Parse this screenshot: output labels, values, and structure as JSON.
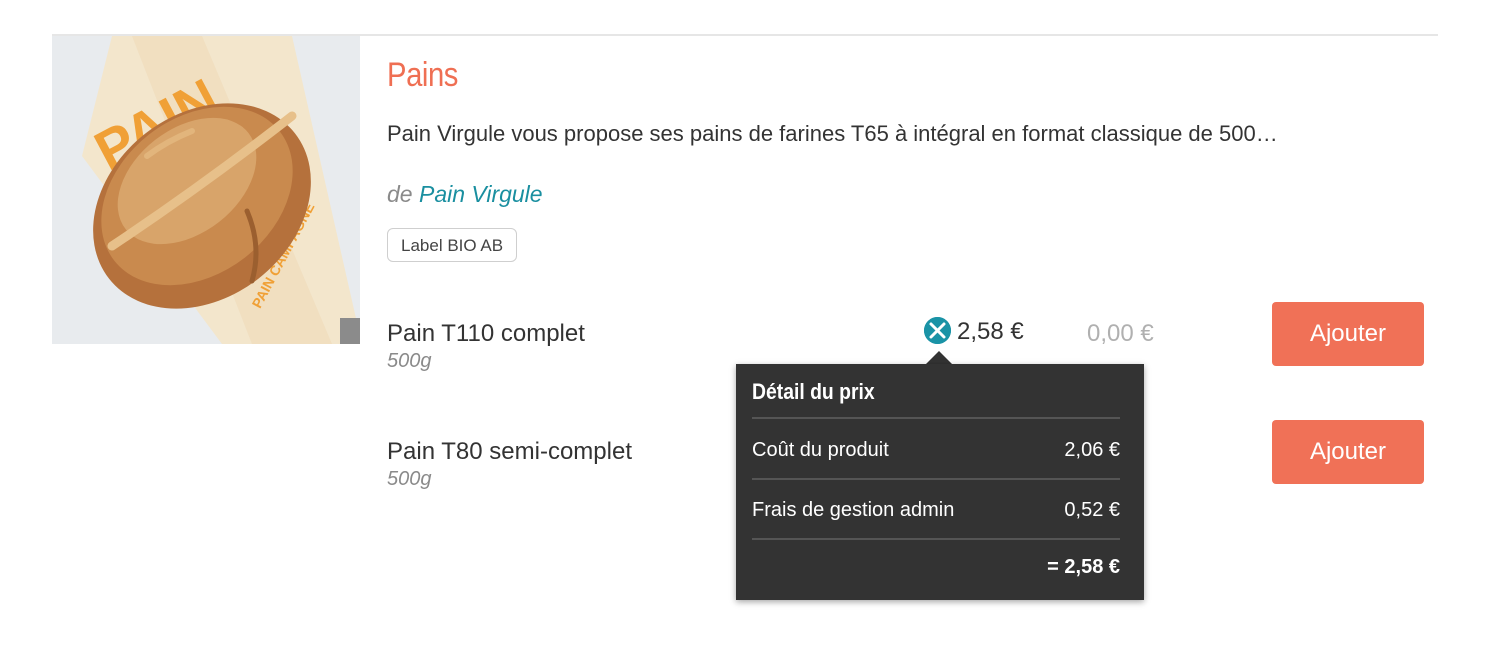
{
  "category": {
    "title": "Pains",
    "description": "Pain Virgule vous propose ses pains de farines T65 à intégral en format classique de 500…",
    "byline_prefix": "de",
    "producer": "Pain Virgule",
    "tag": "Label BIO AB",
    "image_icon": "bread-loaf-image"
  },
  "products": [
    {
      "name": "Pain T110 complet",
      "weight": "500g",
      "unit_price": "2,58 €",
      "total": "0,00 €",
      "add_label": "Ajouter"
    },
    {
      "name": "Pain T80 semi-complet",
      "weight": "500g",
      "add_label": "Ajouter"
    }
  ],
  "price_tooltip": {
    "title": "Détail du prix",
    "rows": [
      {
        "label": "Coût du produit",
        "value": "2,06 €"
      },
      {
        "label": "Frais de gestion admin",
        "value": "0,52 €"
      }
    ],
    "total": "= 2,58 €"
  },
  "colors": {
    "accent": "#f07157",
    "title": "#ef6f53",
    "link": "#1a8fa0",
    "info_icon": "#1a93a6",
    "tooltip_bg": "#333333"
  }
}
